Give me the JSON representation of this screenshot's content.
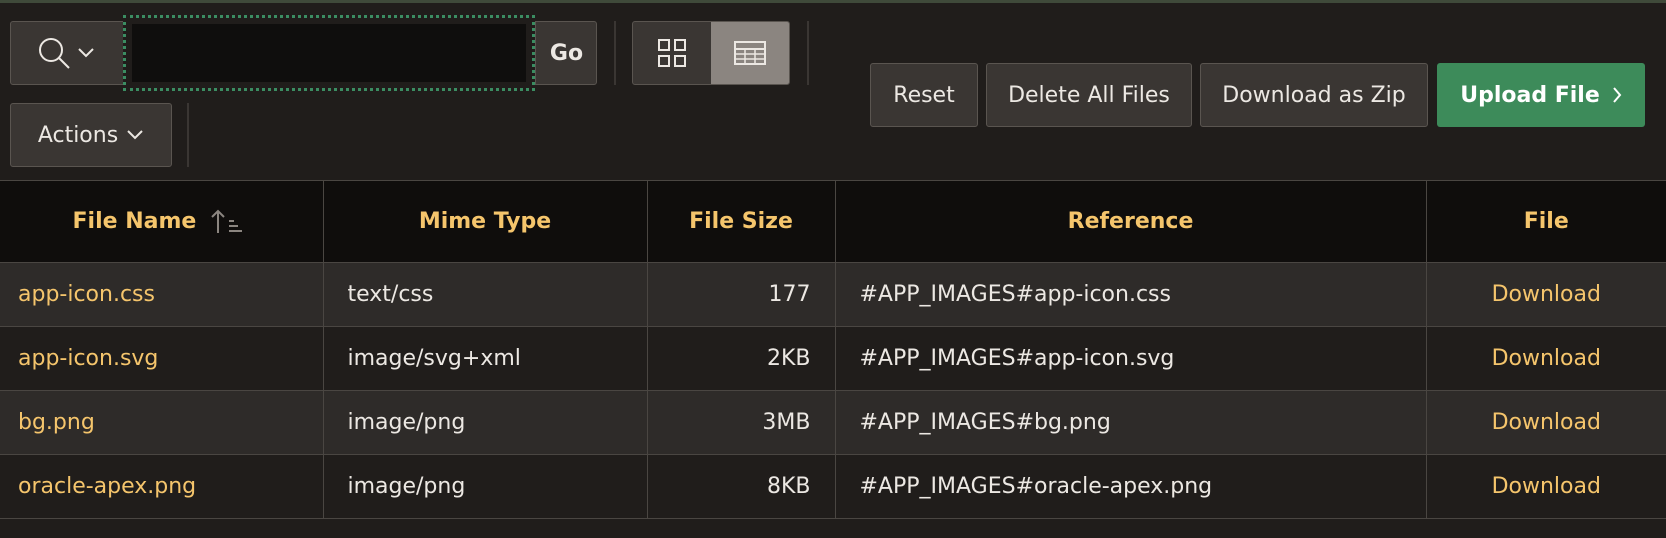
{
  "search": {
    "value": "",
    "placeholder": "",
    "go_label": "Go"
  },
  "toolbar": {
    "actions_label": "Actions",
    "reset_label": "Reset",
    "delete_all_label": "Delete All Files",
    "download_zip_label": "Download as Zip",
    "upload_label": "Upload File",
    "accent_color": "#3d8b5a"
  },
  "views": [
    {
      "name": "grid-view",
      "icon": "grid-icon",
      "active": false
    },
    {
      "name": "report-view",
      "icon": "table-icon",
      "active": true
    }
  ],
  "table": {
    "columns": [
      "File Name",
      "Mime Type",
      "File Size",
      "Reference",
      "File"
    ],
    "sort": {
      "column": "File Name",
      "direction": "ascending"
    },
    "rows": [
      {
        "name": "app-icon.css",
        "mime": "text/css",
        "size": "177",
        "reference": "#APP_IMAGES#app-icon.css",
        "file": "Download"
      },
      {
        "name": "app-icon.svg",
        "mime": "image/svg+xml",
        "size": "2KB",
        "reference": "#APP_IMAGES#app-icon.svg",
        "file": "Download"
      },
      {
        "name": "bg.png",
        "mime": "image/png",
        "size": "3MB",
        "reference": "#APP_IMAGES#bg.png",
        "file": "Download"
      },
      {
        "name": "oracle-apex.png",
        "mime": "image/png",
        "size": "8KB",
        "reference": "#APP_IMAGES#oracle-apex.png",
        "file": "Download"
      }
    ]
  },
  "colors": {
    "header_text": "#f5c56c",
    "link": "#f5c56c",
    "background": "#201d1b"
  }
}
